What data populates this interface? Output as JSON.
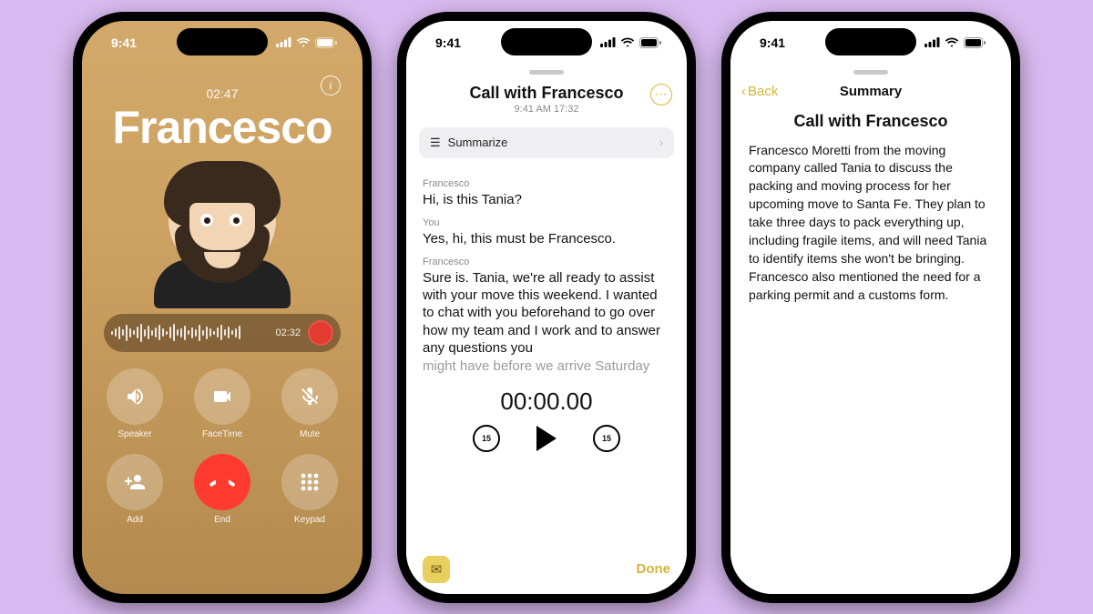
{
  "statusbar": {
    "time": "9:41"
  },
  "phone1": {
    "call_duration": "02:47",
    "caller_name": "Francesco",
    "waveform_time": "02:32",
    "buttons": {
      "speaker": "Speaker",
      "facetime": "FaceTime",
      "mute": "Mute",
      "add": "Add",
      "end": "End",
      "keypad": "Keypad"
    }
  },
  "phone2": {
    "title": "Call with Francesco",
    "subtitle": "9:41 AM  17:32",
    "summarize_label": "Summarize",
    "transcript": [
      {
        "speaker": "Francesco",
        "text": "Hi, is this Tania?"
      },
      {
        "speaker": "You",
        "text": "Yes, hi, this must be Francesco."
      },
      {
        "speaker": "Francesco",
        "text": "Sure is. Tania, we're all ready to assist with your move this weekend. I wanted to chat with you beforehand to go over how my team and I work and to answer any questions you"
      },
      {
        "speaker": "",
        "text": "might have before we arrive Saturday"
      }
    ],
    "player_time": "00:00.00",
    "skip_seconds": "15",
    "done_label": "Done"
  },
  "phone3": {
    "back_label": "Back",
    "nav_title": "Summary",
    "heading": "Call with Francesco",
    "body": "Francesco Moretti from the moving company called Tania to discuss the packing and moving process for her upcoming move to Santa Fe. They plan to take three days to pack everything up, including fragile items, and will need Tania to identify items she won't be bringing. Francesco also mentioned the need for a parking permit and a customs form."
  }
}
